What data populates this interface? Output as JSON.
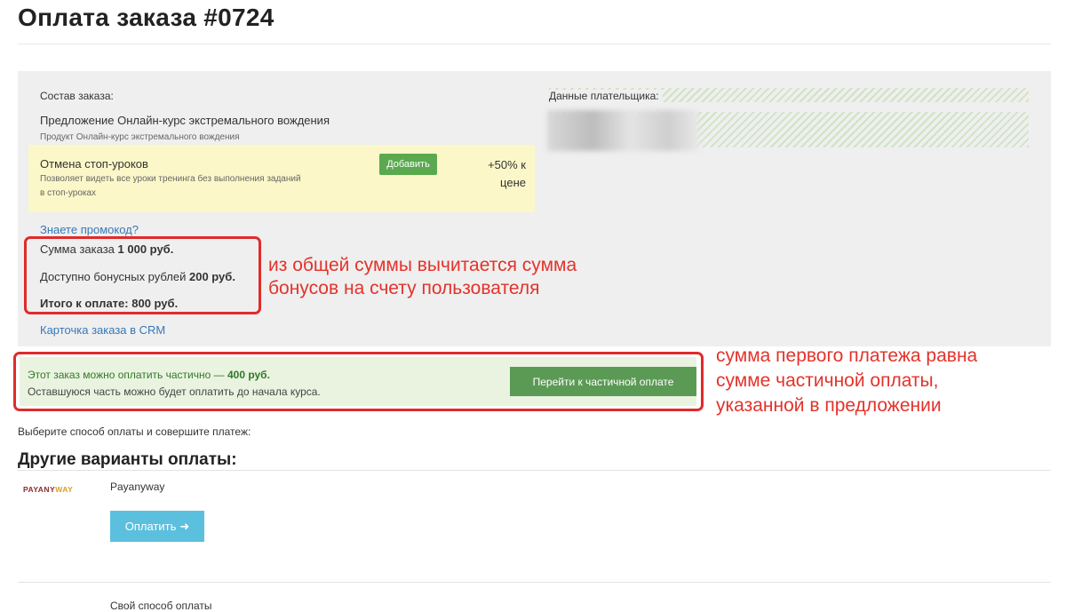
{
  "page": {
    "title": "Оплата заказа #0724"
  },
  "order": {
    "composition_label": "Состав заказа:",
    "offer_title": "Предложение Онлайн-курс экстремального вождения",
    "offer_product": "Продукт Онлайн-курс экстремального вождения",
    "upsell": {
      "title": "Отмена стоп-уроков",
      "description_line1": "Позволяет видеть все уроки тренинга без выполнения заданий",
      "description_line2": "в стоп-уроках",
      "add_button": "Добавить",
      "price_line1": "+50% к",
      "price_line2": "цене"
    },
    "promo_link": "Знаете промокод?",
    "sum_label": "Сумма заказа",
    "sum_value": "1 000 руб.",
    "bonus_label": "Доступно бонусных рублей",
    "bonus_value": "200 руб.",
    "total_label": "Итого к оплате:",
    "total_value": "800 руб.",
    "crm_link": "Карточка заказа в CRM"
  },
  "payer": {
    "label": "Данные плательщика:"
  },
  "partial": {
    "line1_prefix": "Этот заказ можно оплатить частично —",
    "line1_amount": "400 руб.",
    "line2": "Оставшуюся часть можно будет оплатить до начала курса.",
    "button": "Перейти к частичной оплате"
  },
  "choose_method_text": "Выберите способ оплаты и совершите платеж:",
  "other_methods_title": "Другие варианты оплаты:",
  "payanyway": {
    "logo_a": "PAYANY",
    "logo_b": "WAY",
    "name": "Payanyway",
    "pay_button": "Оплатить",
    "pay_arrow": "➜"
  },
  "custom_method": "Свой способ оплаты",
  "annotations": {
    "bonus_line1": "из общей суммы вычитается сумма",
    "bonus_line2": "бонусов на счету пользователя",
    "partial_line1": "сумма первого платежа равна",
    "partial_line2": "сумме частичной оплаты,",
    "partial_line3": "указанной в предложении"
  },
  "colors": {
    "annotation_red": "#e02b2b",
    "add_button_green": "#5aa94f",
    "partial_button_green": "#5b9a55",
    "pay_button_blue": "#5bc0de",
    "link_blue": "#3579b8",
    "upsell_yellow": "#fbf7c8"
  }
}
